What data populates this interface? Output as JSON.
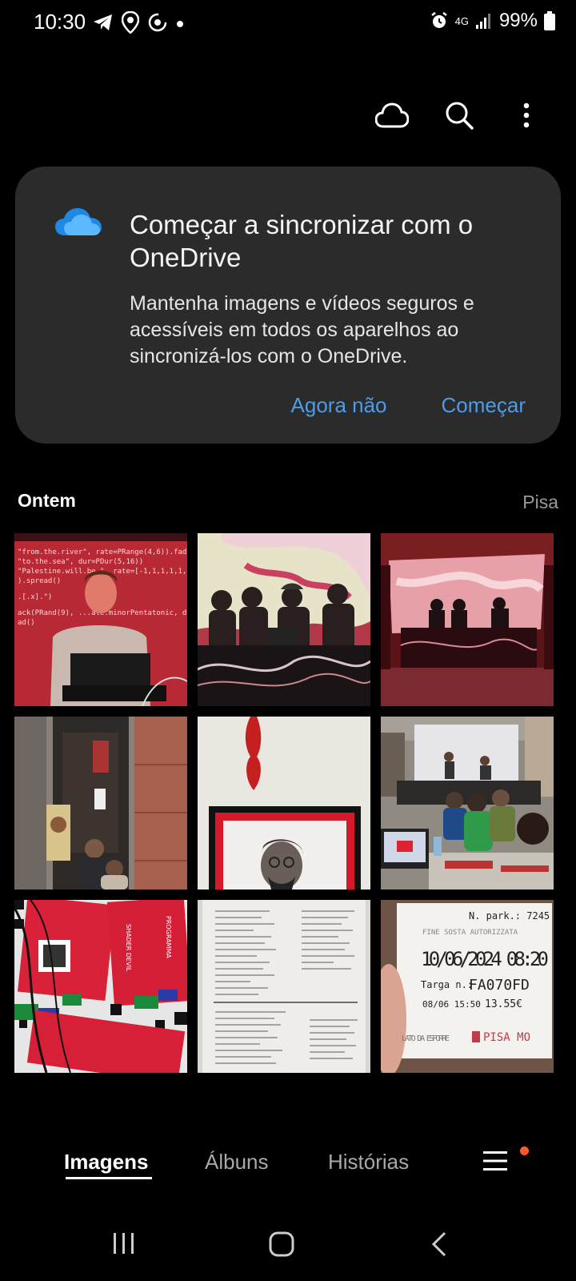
{
  "status_bar": {
    "time": "10:30",
    "network": "4G",
    "battery": "99%",
    "icons": [
      "telegram-icon",
      "location-pin-icon",
      "sync-icon",
      "dot-icon",
      "alarm-icon",
      "signal-icon",
      "battery-icon"
    ]
  },
  "toolbar": {
    "icons": [
      "cloud-icon",
      "search-icon",
      "more-vert-icon"
    ]
  },
  "onedrive_card": {
    "title": "Começar a sincronizar com o OneDrive",
    "body": "Mantenha imagens e vídeos seguros e acessíveis em todos os aparelhos ao sincronizá-los com o OneDrive.",
    "not_now_label": "Agora não",
    "start_label": "Começar",
    "accent_color": "#4e9be6"
  },
  "section": {
    "title": "Ontem",
    "location": "Pisa"
  },
  "photos": [
    {
      "subject": "live-coder-laptop"
    },
    {
      "subject": "performers-at-table"
    },
    {
      "subject": "stage-with-projection"
    },
    {
      "subject": "alley-doorway"
    },
    {
      "subject": "framed-portrait"
    },
    {
      "subject": "workshop-room"
    },
    {
      "subject": "posters-wall"
    },
    {
      "subject": "code-printout"
    },
    {
      "subject": "parking-ticket"
    }
  ],
  "ticket": {
    "park_no": "N. park.: 7245",
    "line1": "FINE SOSTA AUTORIZZATA",
    "date_time": "10/06/2024 08:20",
    "plate_label": "Targa n.:",
    "plate": "FA070FD",
    "end": "08/06 15:50",
    "price": "13.55€",
    "footer_left": "LATO DA ESPORRE",
    "brand": "PISA MO"
  },
  "bottom_nav": {
    "tabs": [
      "Imagens",
      "Álbuns",
      "Histórias"
    ],
    "active": "Imagens",
    "badge_color": "#ff5a2a"
  },
  "system_nav": [
    "recents-icon",
    "home-icon",
    "back-icon"
  ]
}
